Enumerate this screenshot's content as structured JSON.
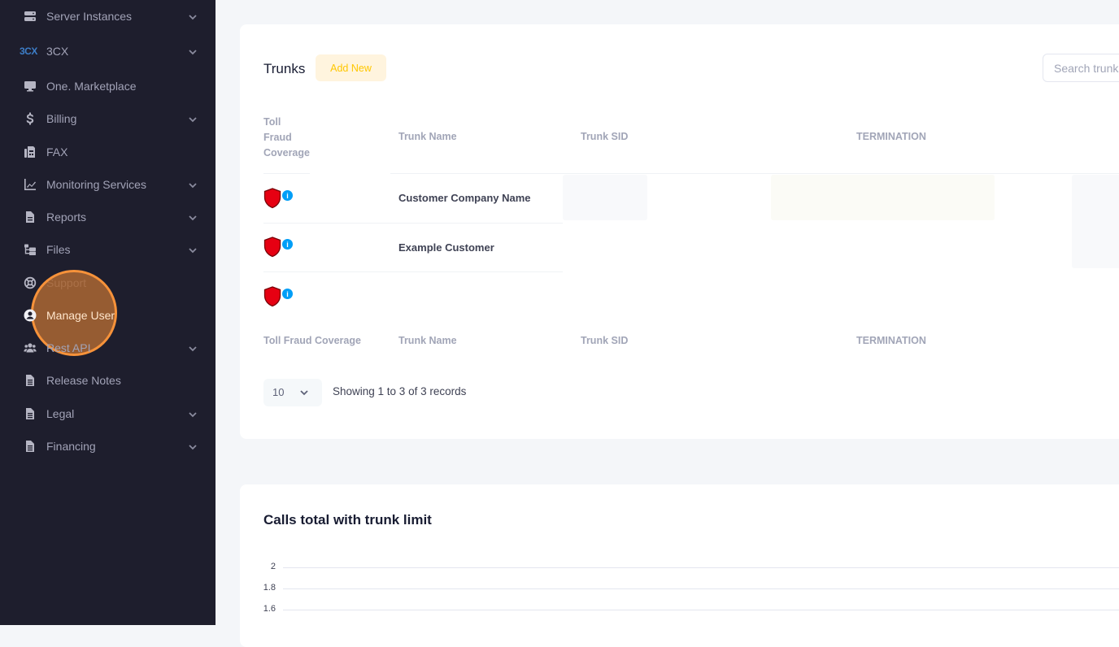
{
  "sidebar": {
    "items": [
      {
        "label": "Server Instances",
        "icon": "server-icon",
        "chevron": true
      },
      {
        "label": "3CX",
        "icon": "3cx-logo",
        "logo_text": "3CX",
        "chevron": true
      },
      {
        "label": "One. Marketplace",
        "icon": "monitor-icon",
        "chevron": false
      },
      {
        "label": "Billing",
        "icon": "dollar-icon",
        "chevron": true
      },
      {
        "label": "FAX",
        "icon": "fax-icon",
        "chevron": false
      },
      {
        "label": "Monitoring Services",
        "icon": "chart-line-icon",
        "chevron": true
      },
      {
        "label": "Reports",
        "icon": "file-icon",
        "chevron": true
      },
      {
        "label": "Files",
        "icon": "folder-tree-icon",
        "chevron": true
      },
      {
        "label": "Support",
        "icon": "life-ring-icon",
        "chevron": false
      },
      {
        "label": "Manage User",
        "icon": "user-circle-icon",
        "chevron": false,
        "active": true
      },
      {
        "label": "Rest API",
        "icon": "users-icon",
        "chevron": true
      },
      {
        "label": "Release Notes",
        "icon": "document-icon",
        "chevron": false
      },
      {
        "label": "Legal",
        "icon": "document-icon",
        "chevron": true
      },
      {
        "label": "Financing",
        "icon": "document-icon",
        "chevron": true
      }
    ],
    "highlight_color": "#f6923a"
  },
  "trunks": {
    "title": "Trunks",
    "add_new_label": "Add New",
    "search_placeholder": "Search trunks",
    "columns": [
      "Toll Fraud Coverage",
      "Trunk Name",
      "Trunk SID",
      "TERMINATION"
    ],
    "header_col0_lines": [
      "Toll",
      "Fraud",
      "Coverage"
    ],
    "rows": [
      {
        "coverage_icon": "shield-icon",
        "info_icon": "info-icon",
        "trunk_name": "Customer Company Name"
      },
      {
        "coverage_icon": "shield-icon",
        "info_icon": "info-icon",
        "trunk_name": "Example Customer"
      },
      {
        "coverage_icon": "shield-icon",
        "info_icon": "info-icon",
        "trunk_name": ""
      }
    ],
    "page_size": "10",
    "records_info": "Showing 1 to 3 of 3 records",
    "shield_color": "#e60012",
    "info_color": "#009ef7"
  },
  "calls_chart": {
    "title": "Calls total with trunk limit"
  },
  "chart_data": {
    "type": "line",
    "title": "Calls total with trunk limit",
    "xlabel": "",
    "ylabel": "",
    "y_ticks": [
      "2",
      "1.8",
      "1.6"
    ],
    "ylim": [
      1.6,
      2
    ],
    "grid": true,
    "series": []
  },
  "colors": {
    "sidebar_bg": "#1e1e2d",
    "page_bg": "#f4f6f9",
    "add_button_bg": "#fff4de",
    "add_button_text": "#ffc700"
  }
}
